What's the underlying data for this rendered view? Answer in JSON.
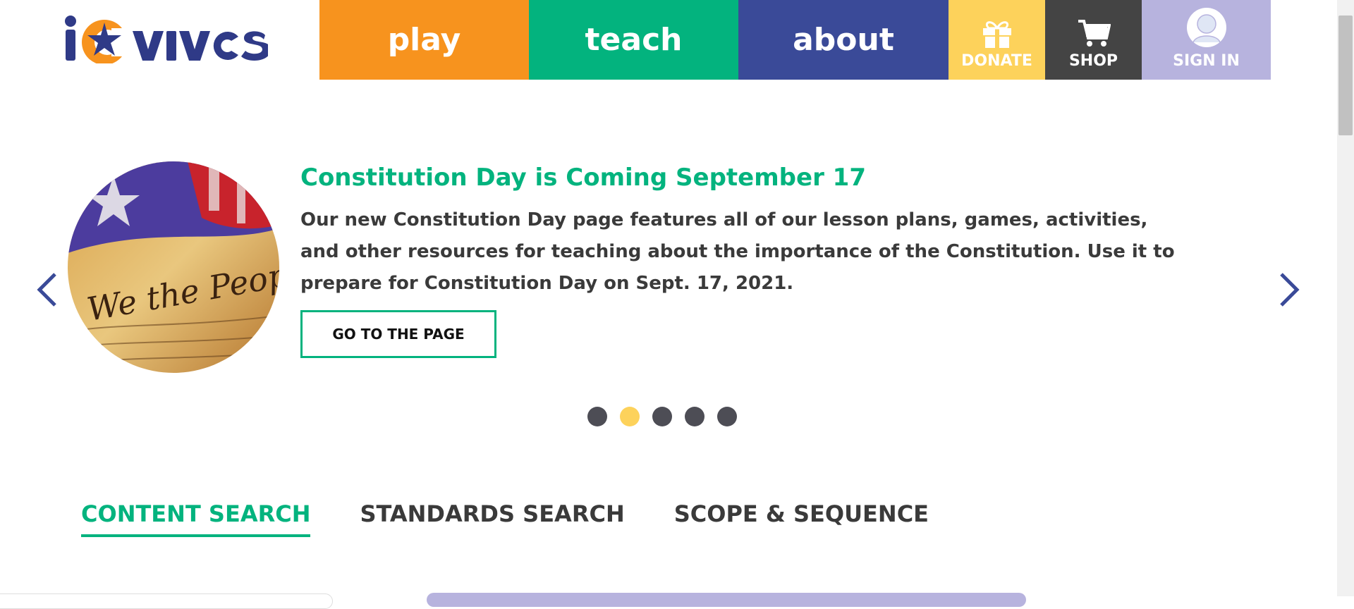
{
  "header": {
    "logo_text": "iCivics",
    "nav": {
      "play": "play",
      "teach": "teach",
      "about": "about",
      "donate": "DONATE",
      "shop": "SHOP",
      "sign_in": "SIGN IN"
    }
  },
  "hero": {
    "title": "Constitution Day is Coming September 17",
    "body": "Our new Constitution Day page features all of our lesson plans, games, activities, and other resources for teaching about the importance of the Constitution. Use it to prepare for Constitution Day on Sept. 17, 2021.",
    "button_label": "GO TO THE PAGE",
    "slides_total": 5,
    "active_slide": 2,
    "image_script": "We the People"
  },
  "tabs": [
    {
      "label": "CONTENT SEARCH",
      "active": true
    },
    {
      "label": "STANDARDS SEARCH",
      "active": false
    },
    {
      "label": "SCOPE & SEQUENCE",
      "active": false
    }
  ],
  "colors": {
    "orange": "#f7931e",
    "green": "#03b37e",
    "navy": "#3a4a98",
    "yellow": "#fdd25b",
    "dark_gray": "#444444",
    "lavender": "#b7b3de"
  },
  "icons": {
    "donate": "gift-icon",
    "shop": "cart-icon",
    "sign_in": "user-avatar-icon",
    "prev": "chevron-left-icon",
    "next": "chevron-right-icon"
  }
}
